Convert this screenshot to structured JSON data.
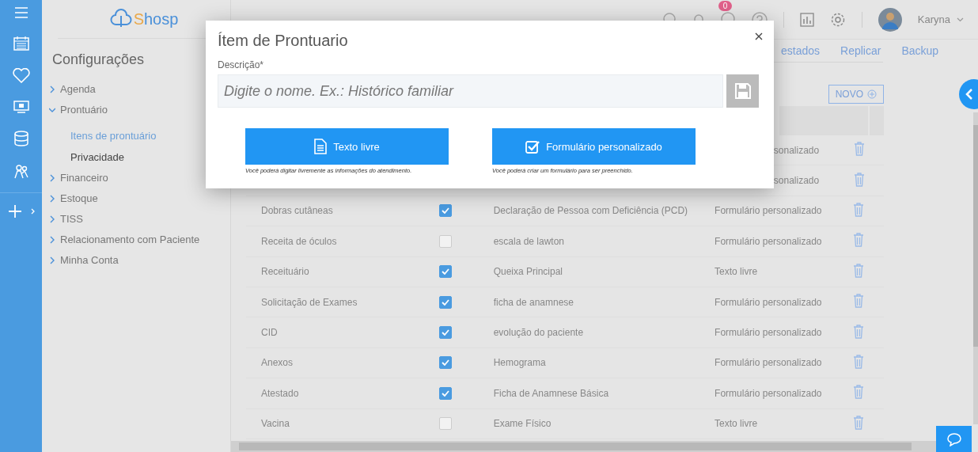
{
  "brand": {
    "name_accent": "S",
    "name_rest": "hosp"
  },
  "topbar": {
    "notification_count": "0",
    "user": "Karyna"
  },
  "settings": {
    "title": "Configurações",
    "items": [
      {
        "label": "Agenda",
        "expanded": false
      },
      {
        "label": "Prontuário",
        "expanded": true,
        "children": [
          {
            "label": "Itens de prontuário",
            "selected": true
          },
          {
            "label": "Privacidade",
            "selected": false
          }
        ]
      },
      {
        "label": "Financeiro",
        "expanded": false
      },
      {
        "label": "Estoque",
        "expanded": false
      },
      {
        "label": "TISS",
        "expanded": false
      },
      {
        "label": "Relacionamento com Paciente",
        "expanded": false
      },
      {
        "label": "Minha Conta",
        "expanded": false
      }
    ]
  },
  "tabs": [
    {
      "label": "estados"
    },
    {
      "label": "Replicar"
    },
    {
      "label": "Backup"
    }
  ],
  "new_button": "NOVO",
  "rows": [
    {
      "kind": "covered",
      "type": "sonalizado"
    },
    {
      "kind": "covered",
      "type": "sonalizado"
    },
    {
      "kind": "full",
      "name": "Dobras cutâneas",
      "checked": true,
      "title": "Declaração de Pessoa com Deficiência (PCD)",
      "type": "Formulário personalizado"
    },
    {
      "kind": "full",
      "name": "Receita de óculos",
      "checked": false,
      "title": "escala de lawton",
      "type": "Formulário personalizado"
    },
    {
      "kind": "full",
      "name": "Receituário",
      "checked": true,
      "title": "Queixa Principal",
      "type": "Texto livre"
    },
    {
      "kind": "full",
      "name": "Solicitação de Exames",
      "checked": true,
      "title": "ficha de anamnese",
      "type": "Formulário personalizado"
    },
    {
      "kind": "full",
      "name": "CID",
      "checked": true,
      "title": "evolução do paciente",
      "type": "Formulário personalizado"
    },
    {
      "kind": "full",
      "name": "Anexos",
      "checked": true,
      "title": "Hemograma",
      "type": "Formulário personalizado"
    },
    {
      "kind": "full",
      "name": "Atestado",
      "checked": true,
      "title": "Ficha de Anamnese Básica",
      "type": "Formulário personalizado"
    },
    {
      "kind": "full",
      "name": "Vacina",
      "checked": false,
      "title": "Exame Físico",
      "type": "Texto livre"
    }
  ],
  "modal": {
    "title": "Ítem de Prontuario",
    "field_label": "Descrição*",
    "placeholder": "Digite o nome. Ex.: Histórico familiar",
    "options": [
      {
        "kind": "text",
        "label": "Texto livre",
        "hint": "Você poderá digitar livremente as informações do atendimento."
      },
      {
        "kind": "form",
        "label": "Formulário personalizado",
        "hint": "Você poderá criar um formulário para ser preenchido."
      }
    ]
  }
}
